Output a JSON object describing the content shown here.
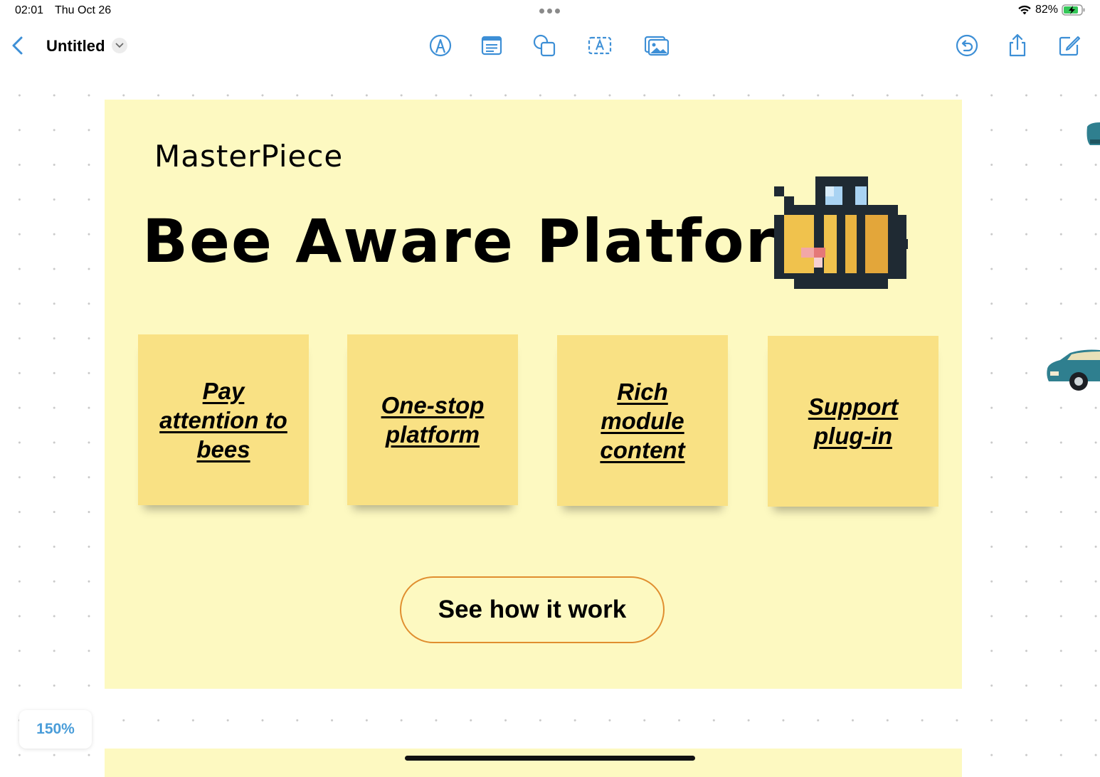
{
  "status_bar": {
    "time": "02:01",
    "date": "Thu Oct 26",
    "battery": "82%"
  },
  "toolbar": {
    "title": "Untitled",
    "icons": [
      "pen-tip-icon",
      "text-box-icon",
      "shapes-icon",
      "text-frame-icon",
      "photo-icon",
      "undo-icon",
      "share-icon",
      "compose-icon"
    ]
  },
  "board": {
    "brand": "MasterPiece",
    "headline": "Bee Aware Platform",
    "notes": [
      {
        "text": "Pay attention to bees"
      },
      {
        "text": "One-stop platform"
      },
      {
        "text": "Rich module content"
      },
      {
        "text": "Support plug-in"
      }
    ],
    "cta_label": "See how it work"
  },
  "zoom": {
    "level": "150%"
  },
  "colors": {
    "accent": "#4a9dd9",
    "board_bg": "#fdf9c1",
    "note_bg": "#f9e184",
    "cta_border": "#e08e2f"
  }
}
